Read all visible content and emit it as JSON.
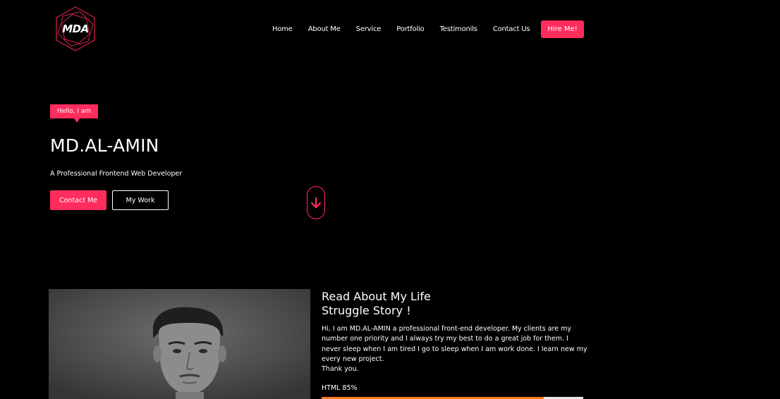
{
  "brand": {
    "logo_text": "MDA"
  },
  "nav": {
    "links": [
      "Home",
      "About Me",
      "Service",
      "Portfolio",
      "Testimonils",
      "Contact Us"
    ],
    "hire_label": "Hire Me!"
  },
  "hero": {
    "badge": "Hello, I am",
    "name": "MD.AL-AMIN",
    "subtitle": "A Professional Frontend Web Developer",
    "contact_label": "Contact Me",
    "work_label": "My Work",
    "scroll_icon": "arrow-down-icon"
  },
  "about": {
    "title_line1": "Read About My Life",
    "title_line2": "Struggle Story !",
    "paragraph": "Hi, I am MD.AL-AMIN a professional front-end developer. My clients are my number one priority and I always try my best to do a great job for them. I never sleep when I am tired I go to sleep when I am work done. I learn new my every new project.",
    "thanks": "Thank you.",
    "skills": [
      {
        "label": "HTML 85%",
        "percent": 85
      }
    ]
  },
  "colors": {
    "accent": "#ff2d5e",
    "background": "#000000",
    "skill_bar": "#f07b22",
    "skill_track": "#e8e8e8"
  }
}
